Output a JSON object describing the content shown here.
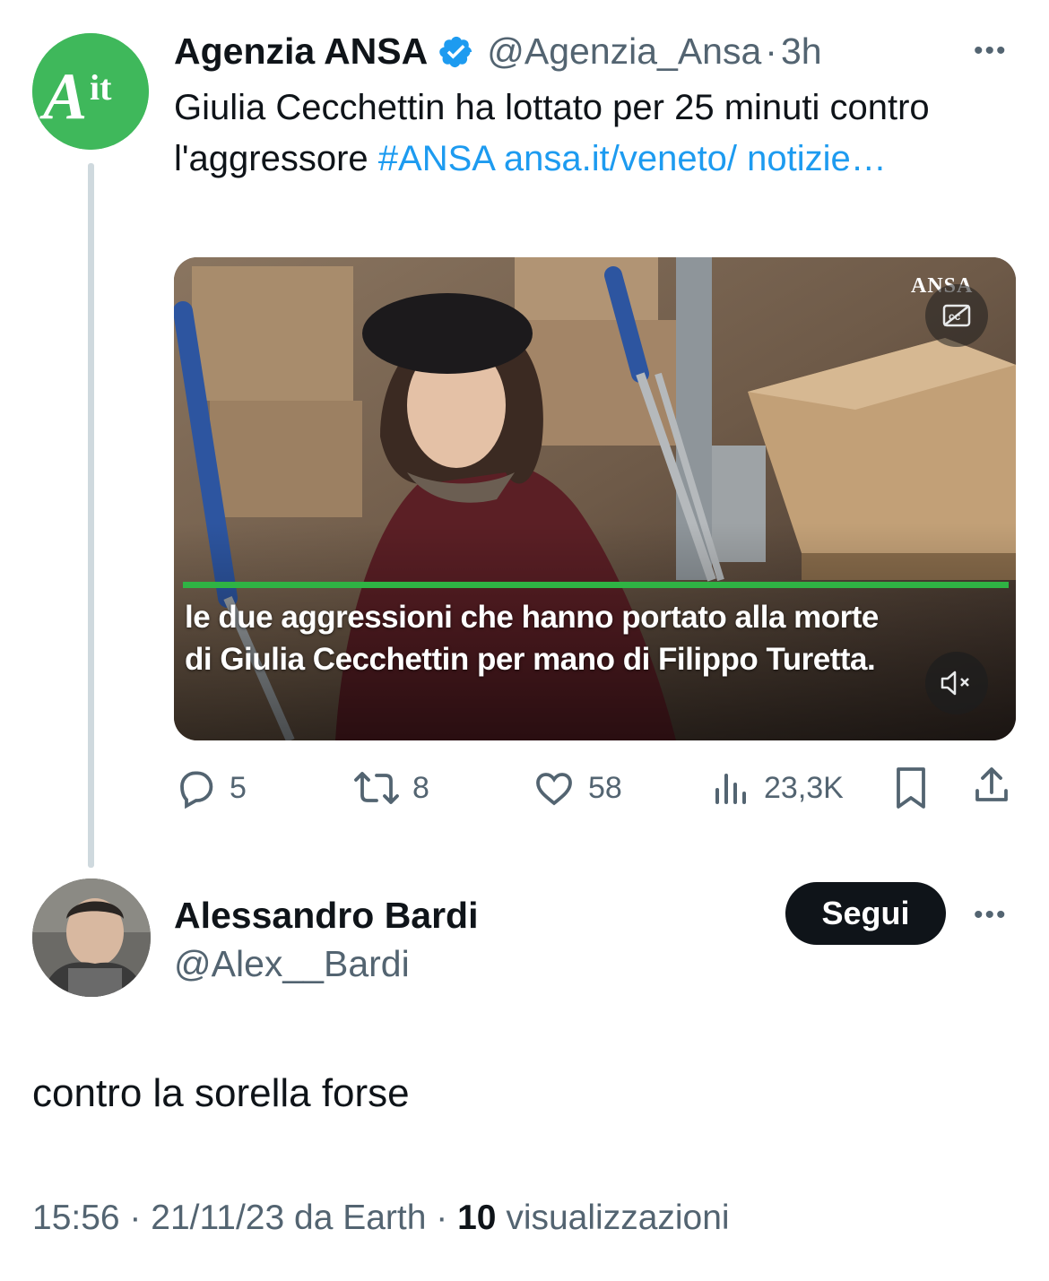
{
  "original_tweet": {
    "avatar_text": "Ait",
    "author_name": "Agenzia ANSA",
    "verified": true,
    "handle": "@Agenzia_Ansa",
    "separator": "·",
    "time": "3h",
    "text": "Giulia Cecchettin ha lottato per 25 minuti contro l'aggressore ",
    "hashtag": "#ANSA",
    "link": "ansa.it/veneto/ notizie…",
    "media": {
      "watermark": "ANSA",
      "caption_line1": "le due aggressioni che hanno portato alla morte",
      "caption_line2": "di Giulia Cecchettin per mano di Filippo Turetta."
    },
    "actions": {
      "replies": "5",
      "retweets": "8",
      "likes": "58",
      "views": "23,3K"
    }
  },
  "reply": {
    "author_name": "Alessandro Bardi",
    "handle": "@Alex__Bardi",
    "follow_label": "Segui",
    "text": "contro la sorella forse",
    "meta_prefix": "15:56 · 21/11/23 da Earth · ",
    "views_count": "10",
    "views_label": " visualizzazioni"
  },
  "colors": {
    "accent": "#1d9bf0",
    "secondary_text": "#536471",
    "ansa_green": "#3fb85b"
  }
}
